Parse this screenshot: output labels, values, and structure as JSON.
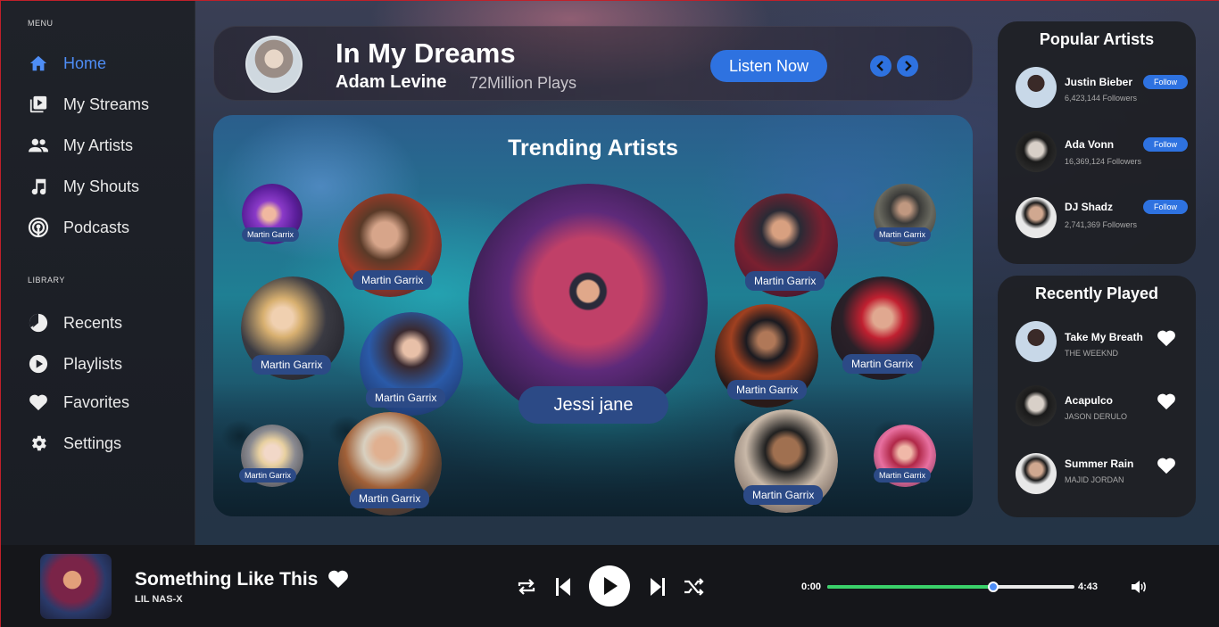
{
  "sidebar": {
    "menu_label": "MENU",
    "library_label": "LIBRARY",
    "menu_items": [
      {
        "label": "Home",
        "icon": "home-icon",
        "active": true
      },
      {
        "label": "My Streams",
        "icon": "streams-icon"
      },
      {
        "label": "My Artists",
        "icon": "people-icon"
      },
      {
        "label": "My Shouts",
        "icon": "music-note-icon"
      },
      {
        "label": "Podcasts",
        "icon": "podcast-icon"
      }
    ],
    "library_items": [
      {
        "label": "Recents",
        "icon": "clock-icon"
      },
      {
        "label": "Playlists",
        "icon": "play-circle-icon"
      },
      {
        "label": "Favorites",
        "icon": "heart-icon"
      },
      {
        "label": "Settings",
        "icon": "gear-icon"
      }
    ]
  },
  "featured": {
    "title": "In My Dreams",
    "artist": "Adam Levine",
    "plays": "72Million Plays",
    "listen_label": "Listen Now"
  },
  "trending": {
    "title": "Trending Artists",
    "featured_artist": "Jessi jane",
    "artists": [
      "Martin Garrix",
      "Martin Garrix",
      "Martin Garrix",
      "Martin Garrix",
      "Martin Garrix",
      "Martin Garrix",
      "Martin Garrix",
      "Martin Garrix",
      "Martin Garrix",
      "Martin Garrix",
      "Martin Garrix",
      "Martin Garrix"
    ]
  },
  "popular": {
    "title": "Popular Artists",
    "follow_label": "Follow",
    "artists": [
      {
        "name": "Justin Bieber",
        "followers": "6,423,144 Followers"
      },
      {
        "name": "Ada Vonn",
        "followers": "16,369,124 Followers"
      },
      {
        "name": "DJ Shadz",
        "followers": "2,741,369 Followers"
      }
    ]
  },
  "recent": {
    "title": "Recently Played",
    "tracks": [
      {
        "title": "Take My Breath",
        "artist": "THE WEEKND"
      },
      {
        "title": "Acapulco",
        "artist": "JASON DERULO"
      },
      {
        "title": "Summer Rain",
        "artist": "MAJID JORDAN"
      }
    ]
  },
  "player": {
    "title": "Something Like This",
    "artist": "LIL NAS-X",
    "current_time": "0:00",
    "total_time": "4:43",
    "progress": 0.67,
    "accent": "#3ad16a",
    "brand": "#2e72e0"
  }
}
